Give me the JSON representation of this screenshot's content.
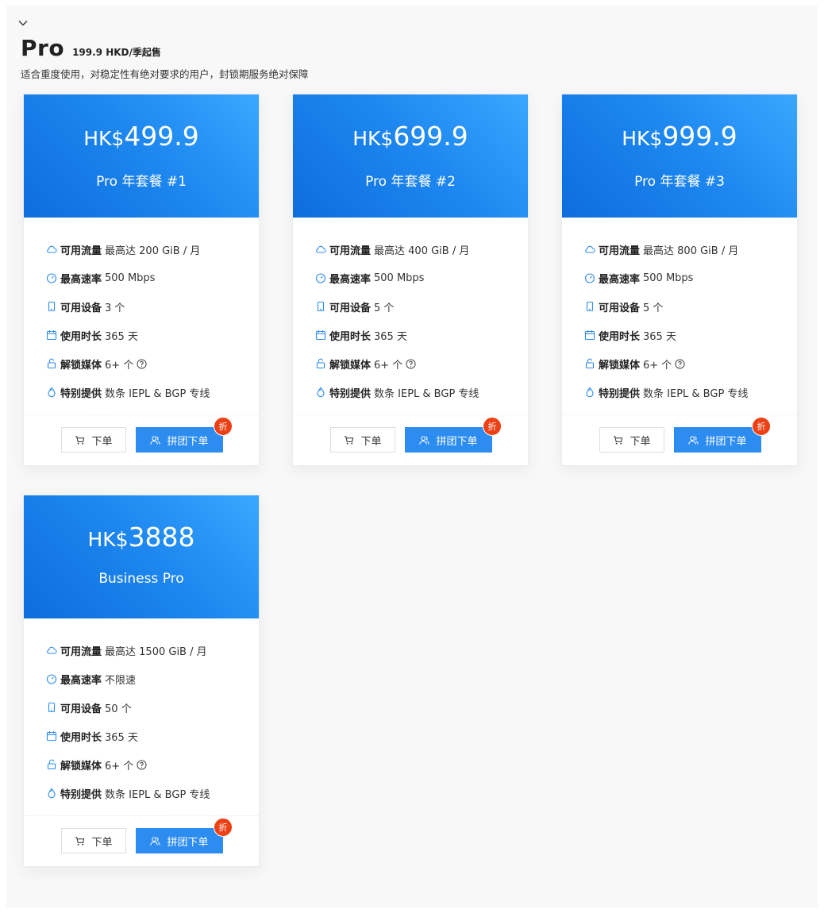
{
  "section": {
    "title": "Pro",
    "price_note": "199.9 HKD/季起售",
    "subtitle": "适合重度使用，对稳定性有绝对要求的用户，封锁期服务绝对保障"
  },
  "labels": {
    "traffic": "可用流量",
    "speed": "最高速率",
    "devices": "可用设备",
    "duration": "使用时长",
    "media": "解锁媒体",
    "special": "特别提供",
    "order": "下单",
    "group_order": "拼团下单",
    "badge": "折"
  },
  "colors": {
    "accent": "#2d8cf0",
    "badge": "#ed4014",
    "icon": "#2d8cf0"
  },
  "plans": [
    {
      "currency": "HK$",
      "price": "499.9",
      "name": "Pro 年套餐 #1",
      "traffic": "最高达 200 GiB / 月",
      "speed": "500 Mbps",
      "devices": "3 个",
      "duration": "365 天",
      "media": "6+ 个",
      "special": "数条 IEPL & BGP 专线"
    },
    {
      "currency": "HK$",
      "price": "699.9",
      "name": "Pro 年套餐 #2",
      "traffic": "最高达 400 GiB / 月",
      "speed": "500 Mbps",
      "devices": "5 个",
      "duration": "365 天",
      "media": "6+ 个",
      "special": "数条 IEPL & BGP 专线"
    },
    {
      "currency": "HK$",
      "price": "999.9",
      "name": "Pro 年套餐 #3",
      "traffic": "最高达 800 GiB / 月",
      "speed": "500 Mbps",
      "devices": "5 个",
      "duration": "365 天",
      "media": "6+ 个",
      "special": "数条 IEPL & BGP 专线"
    },
    {
      "currency": "HK$",
      "price": "3888",
      "name": "Business Pro",
      "traffic": "最高达 1500 GiB / 月",
      "speed": "不限速",
      "devices": "50 个",
      "duration": "365 天",
      "media": "6+ 个",
      "special": "数条 IEPL & BGP 专线"
    }
  ]
}
